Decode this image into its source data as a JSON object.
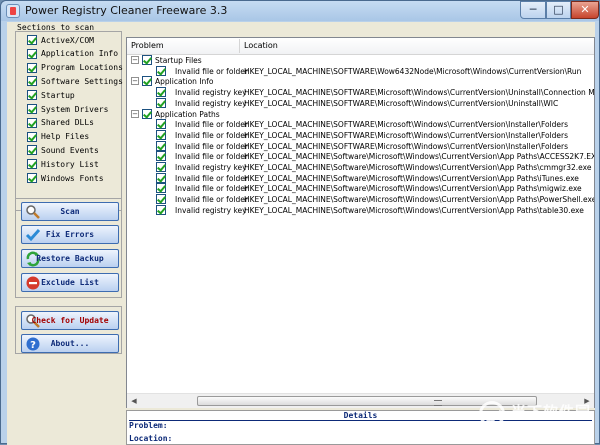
{
  "window": {
    "title": "Power Registry Cleaner Freeware 3.3",
    "minimize": "─",
    "maximize": "□",
    "close": "✕"
  },
  "sections": {
    "title": "Sections to scan",
    "items": [
      {
        "label": "ActiveX/COM",
        "checked": true
      },
      {
        "label": "Application Info",
        "checked": true
      },
      {
        "label": "Program Locations",
        "checked": true
      },
      {
        "label": "Software Settings",
        "checked": true
      },
      {
        "label": "Startup",
        "checked": true
      },
      {
        "label": "System Drivers",
        "checked": true
      },
      {
        "label": "Shared DLLs",
        "checked": true
      },
      {
        "label": "Help Files",
        "checked": true
      },
      {
        "label": "Sound Events",
        "checked": true
      },
      {
        "label": "History List",
        "checked": true
      },
      {
        "label": "Windows Fonts",
        "checked": true
      }
    ]
  },
  "actions": {
    "scan": "Scan",
    "fix": "Fix Errors",
    "restore": "Restore Backup",
    "exclude": "Exclude List",
    "update": "Check for Update",
    "about": "About..."
  },
  "results": {
    "columns": {
      "problem": "Problem",
      "location": "Location"
    },
    "groups": [
      {
        "name": "Startup Files",
        "items": [
          {
            "problem": "Invalid file or folder",
            "location": "HKEY_LOCAL_MACHINE\\SOFTWARE\\Wow6432Node\\Microsoft\\Windows\\CurrentVersion\\Run"
          }
        ]
      },
      {
        "name": "Application Info",
        "items": [
          {
            "problem": "Invalid registry key",
            "location": "HKEY_LOCAL_MACHINE\\SOFTWARE\\Microsoft\\Windows\\CurrentVersion\\Uninstall\\Connection Manager"
          },
          {
            "problem": "Invalid registry key",
            "location": "HKEY_LOCAL_MACHINE\\SOFTWARE\\Microsoft\\Windows\\CurrentVersion\\Uninstall\\WIC"
          }
        ]
      },
      {
        "name": "Application Paths",
        "items": [
          {
            "problem": "Invalid file or folder",
            "location": "HKEY_LOCAL_MACHINE\\SOFTWARE\\Microsoft\\Windows\\CurrentVersion\\Installer\\Folders"
          },
          {
            "problem": "Invalid file or folder",
            "location": "HKEY_LOCAL_MACHINE\\SOFTWARE\\Microsoft\\Windows\\CurrentVersion\\Installer\\Folders"
          },
          {
            "problem": "Invalid file or folder",
            "location": "HKEY_LOCAL_MACHINE\\SOFTWARE\\Microsoft\\Windows\\CurrentVersion\\Installer\\Folders"
          },
          {
            "problem": "Invalid file or folder",
            "location": "HKEY_LOCAL_MACHINE\\Software\\Microsoft\\Windows\\CurrentVersion\\App Paths\\ACCESS2K7.EXE"
          },
          {
            "problem": "Invalid registry key",
            "location": "HKEY_LOCAL_MACHINE\\Software\\Microsoft\\Windows\\CurrentVersion\\App Paths\\cmmgr32.exe"
          },
          {
            "problem": "Invalid file or folder",
            "location": "HKEY_LOCAL_MACHINE\\Software\\Microsoft\\Windows\\CurrentVersion\\App Paths\\iTunes.exe"
          },
          {
            "problem": "Invalid file or folder",
            "location": "HKEY_LOCAL_MACHINE\\Software\\Microsoft\\Windows\\CurrentVersion\\App Paths\\migwiz.exe"
          },
          {
            "problem": "Invalid file or folder",
            "location": "HKEY_LOCAL_MACHINE\\Software\\Microsoft\\Windows\\CurrentVersion\\App Paths\\PowerShell.exe"
          },
          {
            "problem": "Invalid registry key",
            "location": "HKEY_LOCAL_MACHINE\\Software\\Microsoft\\Windows\\CurrentVersion\\App Paths\\table30.exe"
          }
        ]
      }
    ]
  },
  "details": {
    "title": "Details",
    "problem_label": "Problem:",
    "location_label": "Location:"
  },
  "watermark": {
    "text": "当下软件园",
    "url": "www.downxia.com"
  }
}
